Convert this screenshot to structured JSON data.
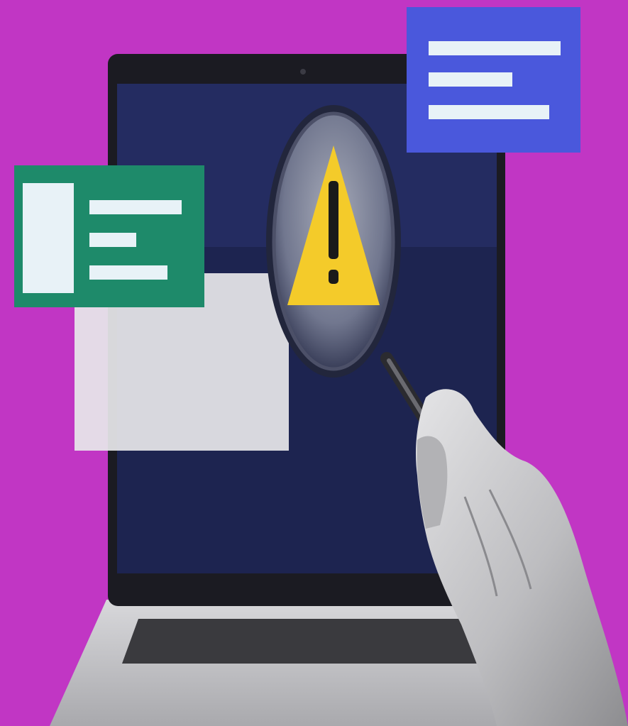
{
  "colors": {
    "background": "#c136c4",
    "screen": "#1d2450",
    "screen_highlight": "#2a3370",
    "bezel": "#1b1b22",
    "laptop_base": "#cfcfd2",
    "keyboard": "#3a3a3e",
    "card_green": "#1e8a6a",
    "card_blue": "#4a58dc",
    "card_lines": "#e8f2f7",
    "overlay_window": "#e6e6ea",
    "lens": "#8f95a8",
    "warning": "#f4cb2a",
    "warning_mark": "#1a1a1a",
    "hand": "#c9c9cb"
  },
  "icons": {
    "warning": "warning-triangle-icon",
    "magnifier": "magnifying-glass-icon"
  }
}
